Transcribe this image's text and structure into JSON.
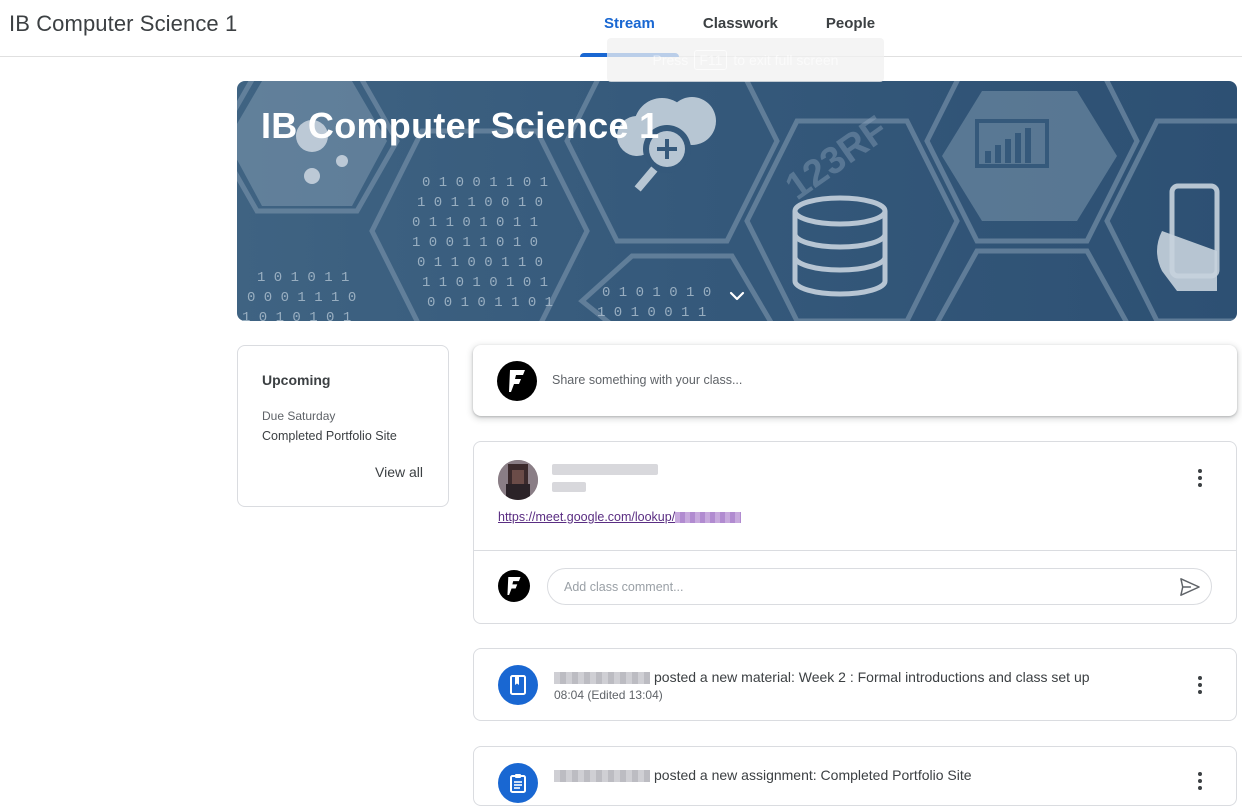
{
  "header": {
    "class_title": "IB Computer Science 1",
    "tabs": [
      "Stream",
      "Classwork",
      "People"
    ],
    "active_tab": "Stream"
  },
  "fullscreen_toast": {
    "prefix": "Press",
    "key": "F11",
    "suffix": "to exit full screen"
  },
  "banner": {
    "title": "IB Computer Science 1"
  },
  "upcoming": {
    "title": "Upcoming",
    "due_label": "Due Saturday",
    "item": "Completed Portfolio Site",
    "view_all": "View all"
  },
  "share": {
    "placeholder": "Share something with your class..."
  },
  "post": {
    "link_prefix": "https://meet.google.com/lookup/",
    "comment_placeholder": "Add class comment..."
  },
  "activities": [
    {
      "text": "posted a new material: Week 2 : Formal introductions and class set up",
      "meta": "08:04 (Edited 13:04)",
      "icon": "book-icon"
    },
    {
      "text": "posted a new assignment: Completed Portfolio Site",
      "meta": "",
      "icon": "assignment-icon"
    }
  ],
  "colors": {
    "accent": "#1967d2",
    "banner": "#35597b",
    "border": "#dadce0",
    "text": "#3c4043"
  }
}
